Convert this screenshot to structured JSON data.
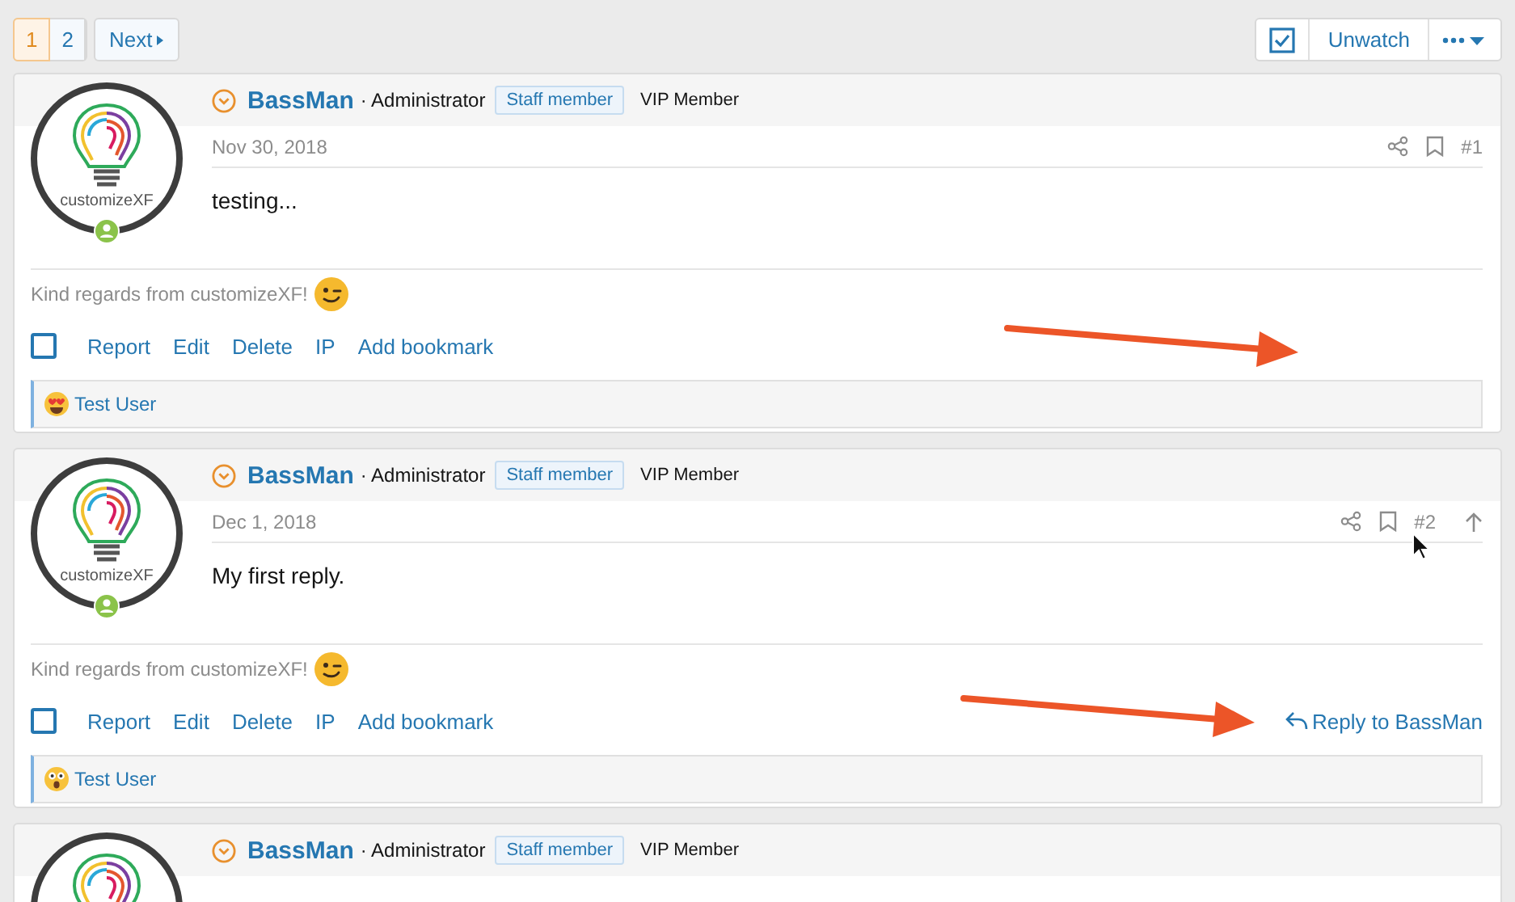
{
  "pagination": {
    "pages": [
      {
        "label": "1",
        "selected": true
      },
      {
        "label": "2",
        "selected": false
      }
    ],
    "next": "Next"
  },
  "thread_actions": {
    "unwatch": "Unwatch"
  },
  "posts": [
    {
      "username": "BassMan",
      "user_title": "· Administrator",
      "banners": [
        {
          "label": "Staff member",
          "kind": "staff"
        },
        {
          "label": "VIP Member",
          "kind": "plain"
        }
      ],
      "avatar_caption": "customizeXF",
      "date": "Nov 30, 2018",
      "number": "#1",
      "show_up": false,
      "body": "testing...",
      "signature": "Kind regards from customizeXF!",
      "select_checked": false,
      "actions": [
        "Report",
        "Edit",
        "Delete",
        "IP",
        "Add bookmark"
      ],
      "reaction": {
        "kind": "heart-eyes",
        "user": "Test User"
      },
      "arrow_annotation": true,
      "cursor": false
    },
    {
      "username": "BassMan",
      "user_title": "· Administrator",
      "banners": [
        {
          "label": "Staff member",
          "kind": "staff"
        },
        {
          "label": "VIP Member",
          "kind": "plain"
        }
      ],
      "avatar_caption": "customizeXF",
      "date": "Dec 1, 2018",
      "number": "#2",
      "show_up": true,
      "body": "My first reply.",
      "signature": "Kind regards from customizeXF!",
      "select_checked": false,
      "actions": [
        "Report",
        "Edit",
        "Delete",
        "IP",
        "Add bookmark"
      ],
      "reply": "Reply to BassMan",
      "reaction": {
        "kind": "surprised",
        "user": "Test User"
      },
      "arrow_annotation": true,
      "cursor": true
    },
    {
      "username": "BassMan",
      "user_title": "· Administrator",
      "banners": [
        {
          "label": "Staff member",
          "kind": "staff"
        },
        {
          "label": "VIP Member",
          "kind": "plain"
        }
      ]
    }
  ]
}
